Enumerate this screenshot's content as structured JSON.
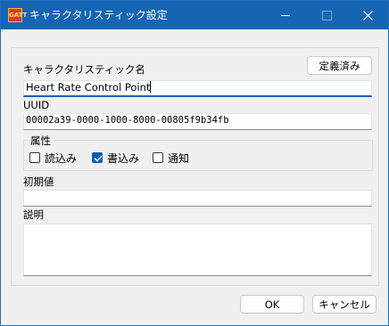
{
  "window": {
    "title": "キャラクタリスティック設定",
    "app_icon_text": "GATT"
  },
  "header": {
    "name_label": "キャラクタリスティック名",
    "defined_button": "定義済み"
  },
  "fields": {
    "name_value": "Heart Rate Control Point",
    "uuid_label": "UUID",
    "uuid_value": "00002a39-0000-1000-8000-00805f9b34fb",
    "initial_label": "初期値",
    "initial_value": "",
    "description_label": "説明",
    "description_value": ""
  },
  "attributes": {
    "label": "属性",
    "read": {
      "label": "読込み",
      "checked": false
    },
    "write": {
      "label": "書込み",
      "checked": true
    },
    "notify": {
      "label": "通知",
      "checked": false
    }
  },
  "footer": {
    "ok": "OK",
    "cancel": "キャンセル"
  },
  "colors": {
    "titlebar": "#1565b3",
    "accent": "#0a5fb4"
  }
}
